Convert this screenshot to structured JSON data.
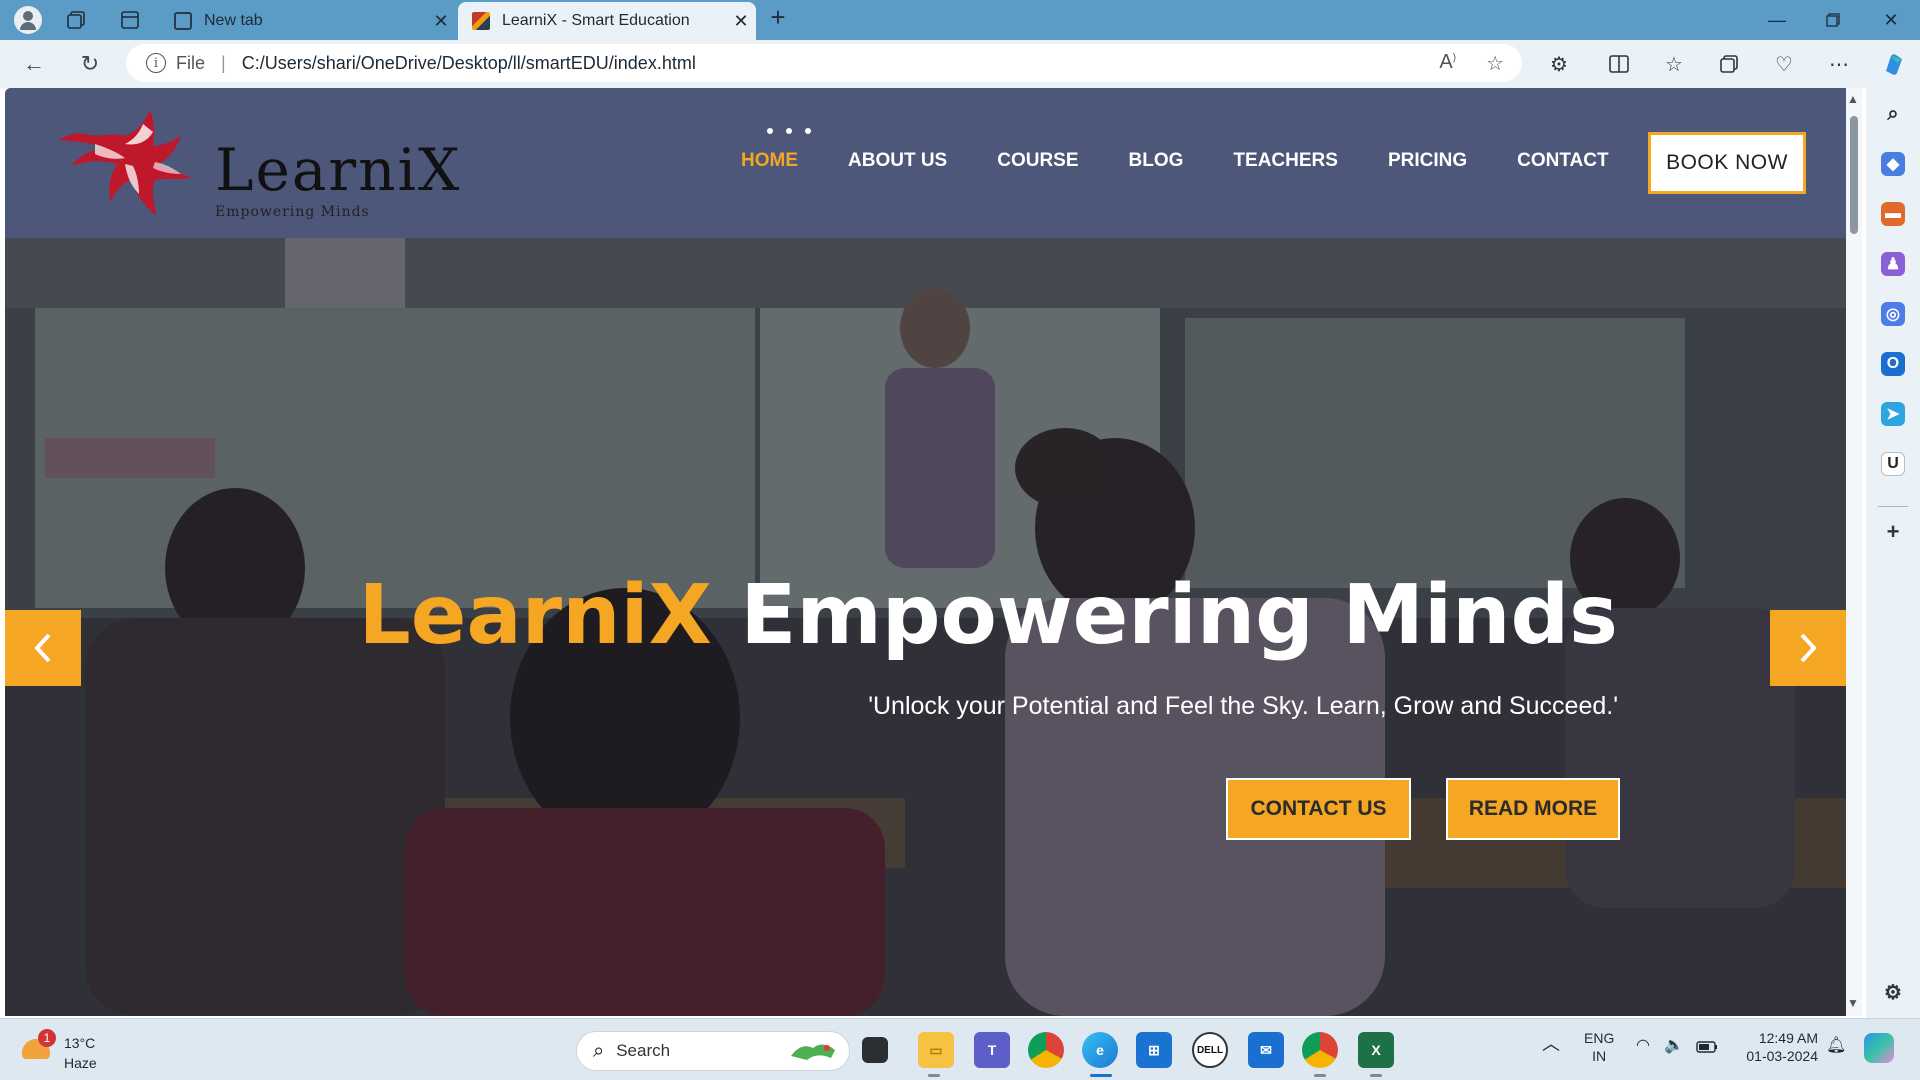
{
  "browser": {
    "tabs": [
      {
        "title": "New tab",
        "active": false
      },
      {
        "title": "LearniX - Smart Education",
        "active": true
      }
    ],
    "address": {
      "scheme_label": "File",
      "url": "C:/Users/shari/OneDrive/Desktop/ll/smartEDU/index.html"
    },
    "icons": {
      "back": "back-arrow-icon",
      "refresh": "refresh-icon",
      "read_aloud": "read-aloud-icon",
      "favorite": "star-icon"
    }
  },
  "site": {
    "logo": {
      "wordmark": "LearniX",
      "tagline": "Empowering Minds"
    },
    "nav": [
      {
        "label": "HOME",
        "active": true
      },
      {
        "label": "ABOUT US",
        "active": false
      },
      {
        "label": "COURSE",
        "active": false
      },
      {
        "label": "BLOG",
        "active": false
      },
      {
        "label": "TEACHERS",
        "active": false
      },
      {
        "label": "PRICING",
        "active": false
      },
      {
        "label": "CONTACT",
        "active": false
      }
    ],
    "book_button": "BOOK NOW",
    "hero": {
      "title_brand": "LearniX",
      "title_rest": " Empowering Minds",
      "subtitle": "'Unlock your Potential and Feel the Sky. Learn, Grow and Succeed.'",
      "buttons": [
        "CONTACT US",
        "READ MORE"
      ]
    },
    "colors": {
      "accent": "#f5a623",
      "header": "#4d5779",
      "text": "#ffffff"
    }
  },
  "taskbar": {
    "weather": {
      "badge": "1",
      "temp": "13°C",
      "condition": "Haze"
    },
    "search_placeholder": "Search",
    "tray": {
      "language": "ENG",
      "region": "IN",
      "time": "12:49 AM",
      "date": "01-03-2024"
    }
  }
}
